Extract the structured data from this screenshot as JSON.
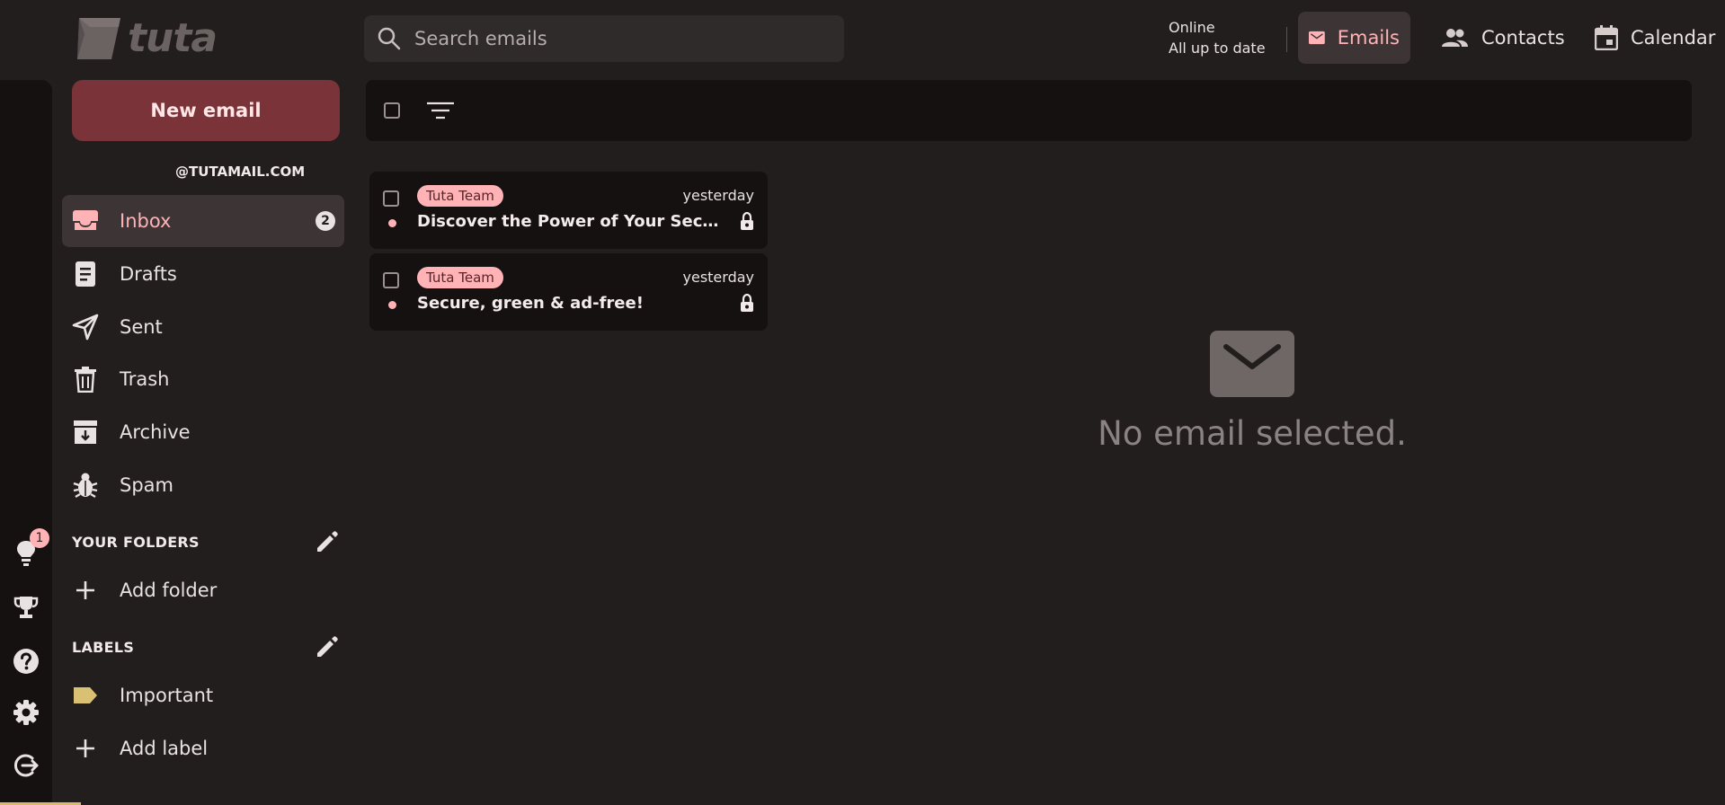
{
  "app": {
    "logo_text": "tuta"
  },
  "search": {
    "placeholder": "Search emails"
  },
  "sync_status": {
    "line1": "Online",
    "line2": "All up to date"
  },
  "nav": {
    "emails": "Emails",
    "contacts": "Contacts",
    "calendar": "Calendar"
  },
  "rail": {
    "tips_badge": "1"
  },
  "sidebar": {
    "new_email": "New email",
    "account": "@TUTAMAIL.COM",
    "folders": [
      {
        "label": "Inbox",
        "icon": "inbox-icon",
        "count": "2",
        "active": true
      },
      {
        "label": "Drafts",
        "icon": "drafts-icon"
      },
      {
        "label": "Sent",
        "icon": "sent-icon"
      },
      {
        "label": "Trash",
        "icon": "trash-icon"
      },
      {
        "label": "Archive",
        "icon": "archive-icon"
      },
      {
        "label": "Spam",
        "icon": "spam-icon"
      }
    ],
    "your_folders_title": "YOUR FOLDERS",
    "add_folder": "Add folder",
    "labels_title": "LABELS",
    "labels": [
      {
        "label": "Important",
        "color": "#d9c073"
      }
    ],
    "add_label": "Add label"
  },
  "mails": [
    {
      "sender": "Tuta Team",
      "date": "yesterday",
      "subject": "Discover the Power of Your Secure Tuta Mail",
      "unread": true
    },
    {
      "sender": "Tuta Team",
      "date": "yesterday",
      "subject": "Secure, green & ad-free!",
      "unread": true
    }
  ],
  "viewer": {
    "empty_text": "No email selected."
  },
  "colors": {
    "accent": "#ffb3b6",
    "new_email_bg": "#7a3338",
    "background": "#221e1e",
    "panel": "#151111"
  }
}
